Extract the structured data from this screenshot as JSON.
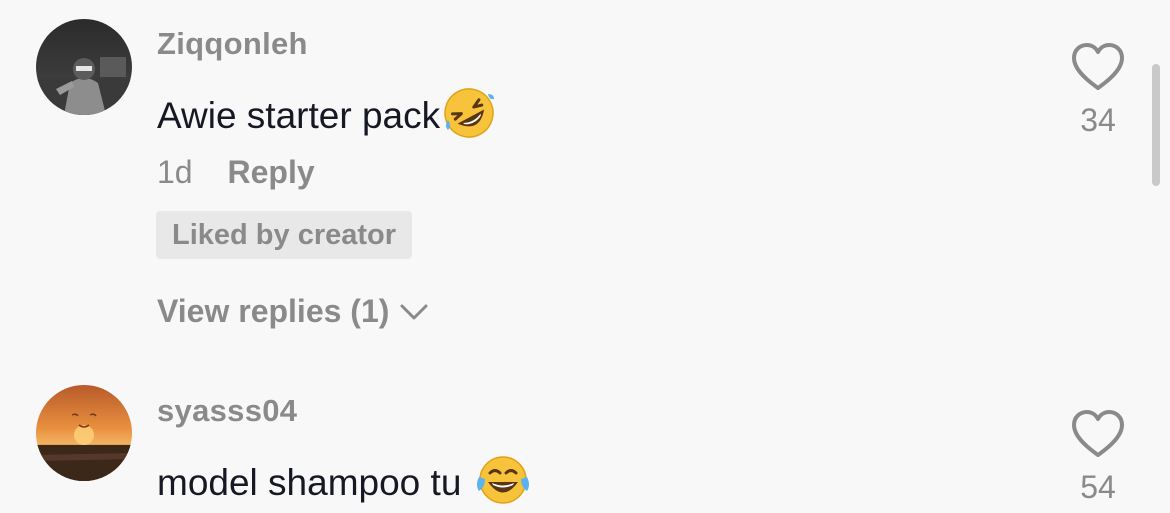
{
  "comments": [
    {
      "username": "Ziqqonleh",
      "text": "Awie starter pack",
      "emoji": "rolling-on-floor-laughing",
      "time": "1d",
      "reply_label": "Reply",
      "liked_by_creator": "Liked by creator",
      "view_replies": "View replies (1)",
      "likes": "34"
    },
    {
      "username": "syasss04",
      "text": "model shampoo tu",
      "emoji": "face-with-tears-of-joy",
      "likes": "54"
    }
  ],
  "colors": {
    "background": "#f8f8f8",
    "text_primary": "#161823",
    "text_secondary": "#8a8a8a",
    "badge_bg": "#e8e8e8"
  },
  "icons": {
    "like": "heart-outline-icon",
    "expand": "chevron-down-icon"
  }
}
